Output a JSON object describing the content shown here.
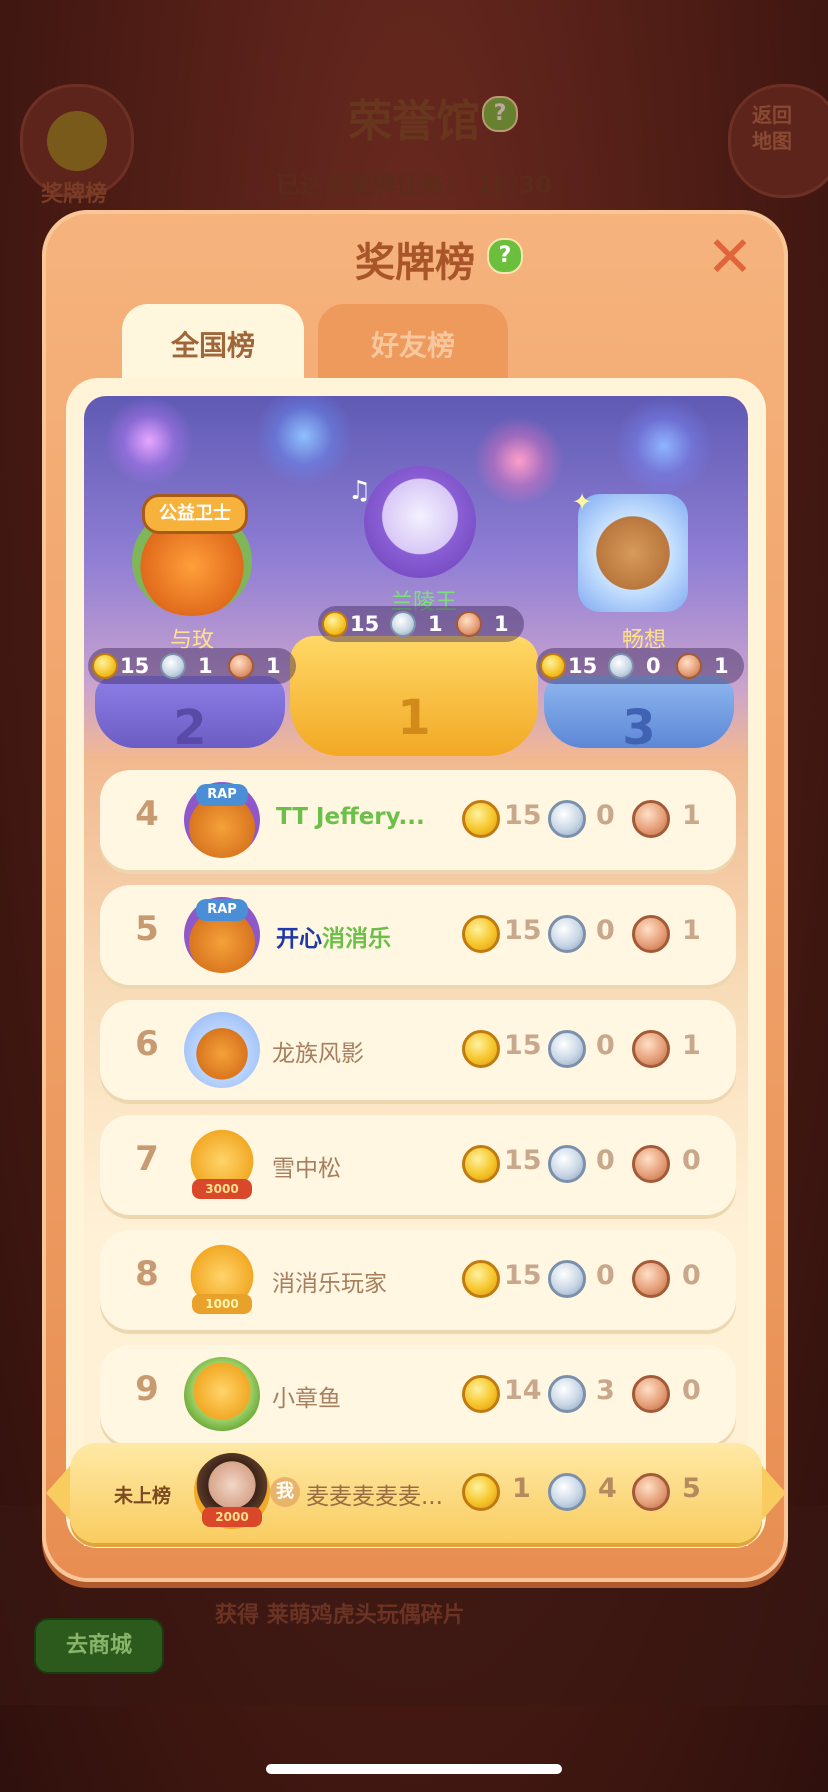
{
  "background": {
    "title": "荣誉馆",
    "progress_label": "已达成奖牌任务：",
    "progress_value": "10/30",
    "medal_board_label": "奖牌榜",
    "back_label_line1": "返回",
    "back_label_line2": "地图",
    "shop_label": "去商城",
    "reward_prefix": "获得",
    "reward_item": "莱萌鸡虎头玩偶碎片"
  },
  "panel": {
    "title": "奖牌榜",
    "help": "?",
    "close": "✕",
    "tabs": [
      {
        "label": "全国榜",
        "active": true
      },
      {
        "label": "好友榜",
        "active": false
      }
    ]
  },
  "top3": [
    {
      "rank": "1",
      "name": "兰陵王",
      "gold": "15",
      "silver": "1",
      "bronze": "1",
      "name_color": "#7be07a"
    },
    {
      "rank": "2",
      "name": "与玫",
      "gold": "15",
      "silver": "1",
      "bronze": "1",
      "name_color": "#ffe08a",
      "badge": "公益卫士"
    },
    {
      "rank": "3",
      "name": "畅想",
      "gold": "15",
      "silver": "0",
      "bronze": "1",
      "name_color": "#ffe08a"
    }
  ],
  "rows": [
    {
      "rank": "4",
      "name": "TT Jeffery...",
      "gold": "15",
      "silver": "0",
      "bronze": "1",
      "avatar_label": "RAP"
    },
    {
      "rank": "5",
      "name_part1": "开心",
      "name_part2": "消",
      "name_part3": "消乐",
      "gold": "15",
      "silver": "0",
      "bronze": "1",
      "avatar_label": "RAP"
    },
    {
      "rank": "6",
      "name": "龙族风影",
      "gold": "15",
      "silver": "0",
      "bronze": "1"
    },
    {
      "rank": "7",
      "name": "雪中松",
      "gold": "15",
      "silver": "0",
      "bronze": "0",
      "avatar_label": "3000"
    },
    {
      "rank": "8",
      "name": "消消乐玩家",
      "gold": "15",
      "silver": "0",
      "bronze": "0",
      "avatar_label": "1000"
    },
    {
      "rank": "9",
      "name": "小章鱼",
      "gold": "14",
      "silver": "3",
      "bronze": "0"
    }
  ],
  "me": {
    "rank_label": "未上榜",
    "me_tag": "我",
    "name": "麦麦麦麦麦...",
    "gold": "1",
    "silver": "4",
    "bronze": "5",
    "avatar_label": "2000"
  },
  "colors": {
    "panel_orange": "#f6b37d",
    "gold": "#f6c62a",
    "silver": "#c9d7e6",
    "bronze": "#e6a07a",
    "row_bg": "#fff7e2",
    "name_green": "#6cc04a",
    "name_blue": "#1f3aa8"
  }
}
